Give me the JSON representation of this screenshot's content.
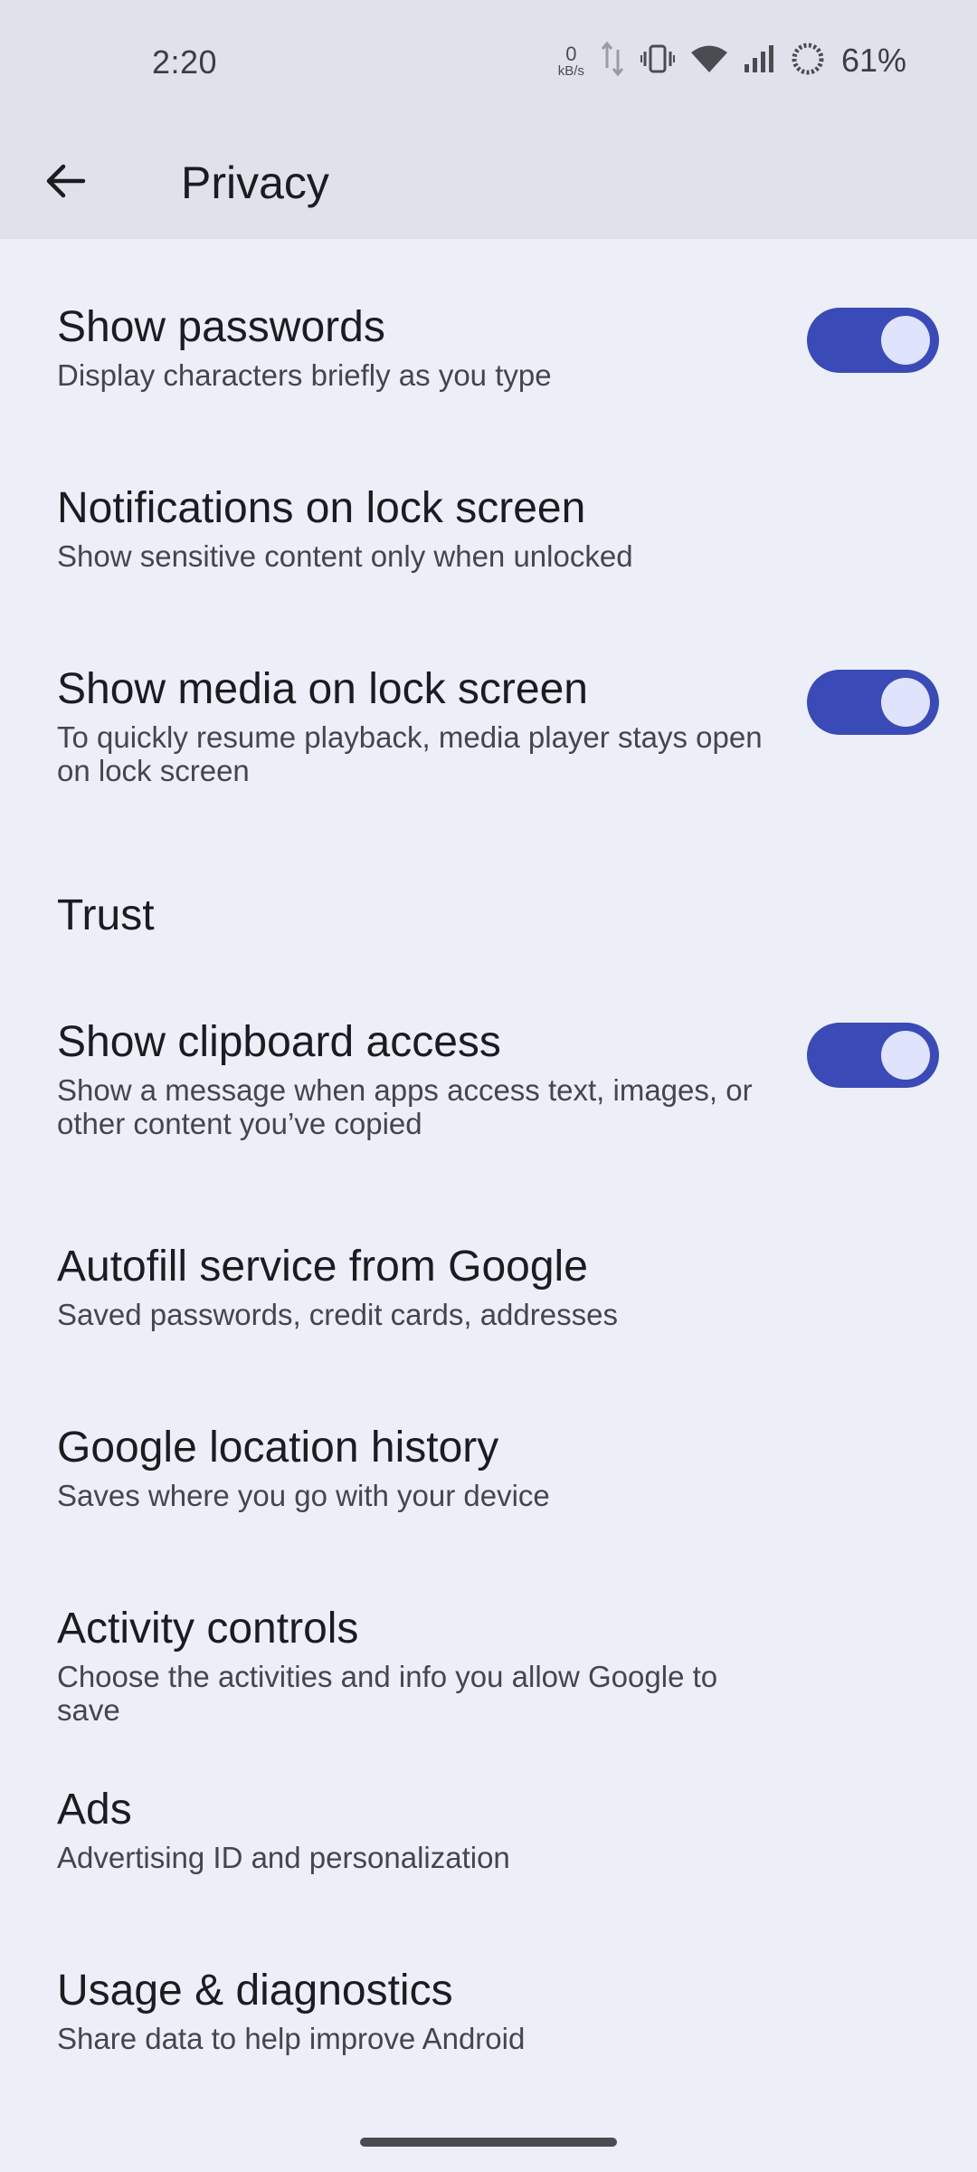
{
  "status_bar": {
    "time": "2:20",
    "net_speed_value": "0",
    "net_speed_unit": "kB/s",
    "battery_percent": "61%",
    "icons": [
      "data-arrows-icon",
      "vibrate-icon",
      "wifi-icon",
      "signal-icon",
      "battery-ring-icon"
    ]
  },
  "app_bar": {
    "title": "Privacy",
    "back_icon": "arrow-back-icon"
  },
  "settings": [
    {
      "title": "Show passwords",
      "subtitle": "Display characters briefly as you type",
      "toggle_on": true
    },
    {
      "title": "Notifications on lock screen",
      "subtitle": "Show sensitive content only when unlocked"
    },
    {
      "title": "Show media on lock screen",
      "subtitle": "To quickly resume playback, media player stays open on lock screen",
      "toggle_on": true
    },
    {
      "title": "Trust"
    },
    {
      "title": "Show clipboard access",
      "subtitle": "Show a message when apps access text, images, or other content you’ve copied",
      "toggle_on": true
    },
    {
      "title": "Autofill service from Google",
      "subtitle": "Saved passwords, credit cards, addresses"
    },
    {
      "title": "Google location history",
      "subtitle": "Saves where you go with your device"
    },
    {
      "title": "Activity controls",
      "subtitle": "Choose the activities and info you allow Google to save"
    },
    {
      "title": "Ads",
      "subtitle": "Advertising ID and personalization"
    },
    {
      "title": "Usage & diagnostics",
      "subtitle": "Share data to help improve Android"
    }
  ],
  "colors": {
    "accent": "#3a4ab6",
    "knob": "#dfe3fb",
    "background": "#eceff8",
    "app_bar": "#dfe2ea"
  }
}
